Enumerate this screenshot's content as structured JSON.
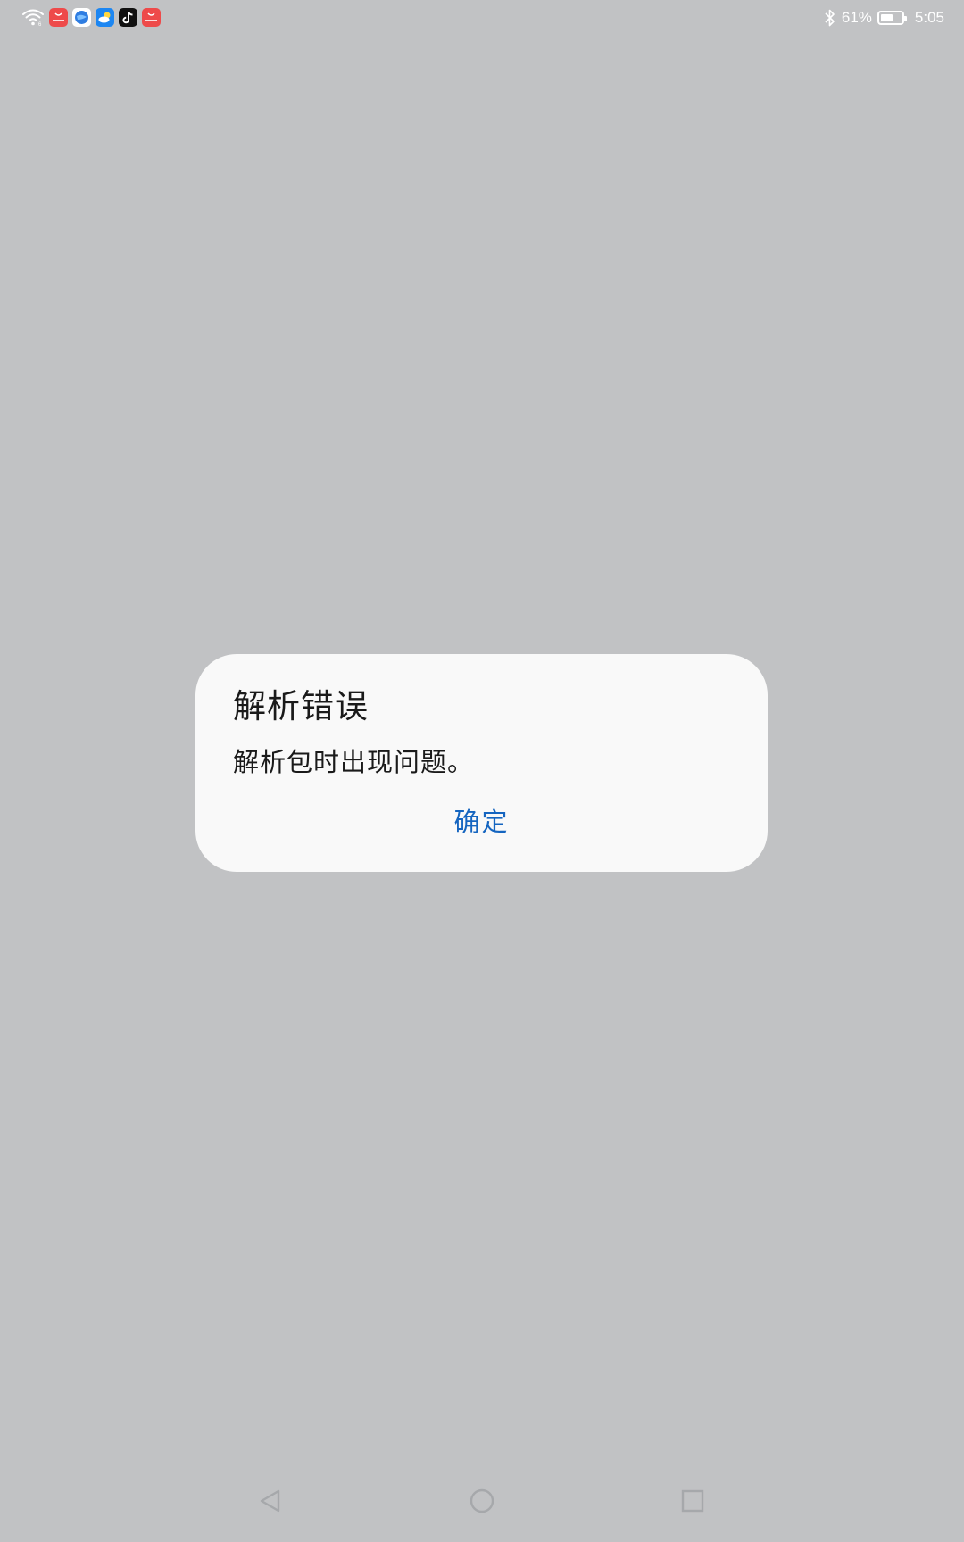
{
  "status_bar": {
    "battery_percent": "61%",
    "battery_level": 0.61,
    "time": "5:05",
    "notification_icons": [
      "wifi-icon",
      "huawei-appgallery-icon",
      "browser-icon",
      "weather-icon",
      "tiktok-icon",
      "huawei-appgallery-icon"
    ]
  },
  "dialog": {
    "title": "解析错误",
    "message": "解析包时出现问题。",
    "confirm_label": "确定"
  },
  "navigation_bar": {
    "back": "back-icon",
    "home": "home-icon",
    "recents": "recents-icon"
  },
  "colors": {
    "background": "#c1c2c4",
    "dialog_background": "#f9f9f9",
    "accent": "#1565c0"
  }
}
